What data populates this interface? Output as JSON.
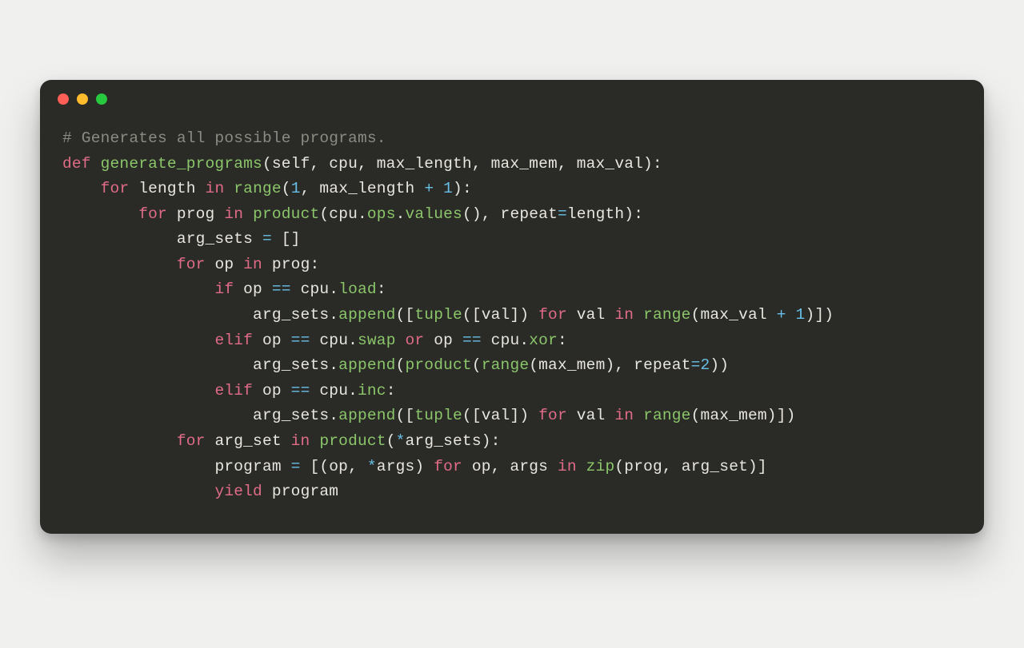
{
  "colors": {
    "window_bg": "#2a2a26",
    "page_bg": "#f0f0ef",
    "traffic_red": "#ff5f56",
    "traffic_yellow": "#ffbd2e",
    "traffic_green": "#27c93f",
    "comment": "#8b8b84",
    "keyword": "#e06c87",
    "function": "#8bc66a",
    "default": "#e8e6df",
    "number": "#68c0e8"
  },
  "code": {
    "lines": [
      {
        "indent": 0,
        "tokens": [
          {
            "t": "# Generates all possible programs.",
            "c": "c-comment"
          }
        ]
      },
      {
        "indent": 0,
        "tokens": [
          {
            "t": "def ",
            "c": "c-kw"
          },
          {
            "t": "generate_programs",
            "c": "c-fn"
          },
          {
            "t": "(",
            "c": "c-id"
          },
          {
            "t": "self",
            "c": "c-self"
          },
          {
            "t": ", cpu, max_length, max_mem, max_val):",
            "c": "c-id"
          }
        ]
      },
      {
        "indent": 1,
        "tokens": [
          {
            "t": "for ",
            "c": "c-kw"
          },
          {
            "t": "length ",
            "c": "c-id"
          },
          {
            "t": "in ",
            "c": "c-kw"
          },
          {
            "t": "range",
            "c": "c-fn"
          },
          {
            "t": "(",
            "c": "c-id"
          },
          {
            "t": "1",
            "c": "c-num"
          },
          {
            "t": ", max_length ",
            "c": "c-id"
          },
          {
            "t": "+ ",
            "c": "c-op"
          },
          {
            "t": "1",
            "c": "c-num"
          },
          {
            "t": "):",
            "c": "c-id"
          }
        ]
      },
      {
        "indent": 2,
        "tokens": [
          {
            "t": "for ",
            "c": "c-kw"
          },
          {
            "t": "prog ",
            "c": "c-id"
          },
          {
            "t": "in ",
            "c": "c-kw"
          },
          {
            "t": "product",
            "c": "c-fn"
          },
          {
            "t": "(cpu.",
            "c": "c-id"
          },
          {
            "t": "ops",
            "c": "c-fn"
          },
          {
            "t": ".",
            "c": "c-id"
          },
          {
            "t": "values",
            "c": "c-fn"
          },
          {
            "t": "(), repeat",
            "c": "c-id"
          },
          {
            "t": "=",
            "c": "c-op"
          },
          {
            "t": "length):",
            "c": "c-id"
          }
        ]
      },
      {
        "indent": 3,
        "tokens": [
          {
            "t": "arg_sets ",
            "c": "c-id"
          },
          {
            "t": "= ",
            "c": "c-op"
          },
          {
            "t": "[]",
            "c": "c-id"
          }
        ]
      },
      {
        "indent": 3,
        "tokens": [
          {
            "t": "for ",
            "c": "c-kw"
          },
          {
            "t": "op ",
            "c": "c-id"
          },
          {
            "t": "in ",
            "c": "c-kw"
          },
          {
            "t": "prog:",
            "c": "c-id"
          }
        ]
      },
      {
        "indent": 4,
        "tokens": [
          {
            "t": "if ",
            "c": "c-kw"
          },
          {
            "t": "op ",
            "c": "c-id"
          },
          {
            "t": "== ",
            "c": "c-op"
          },
          {
            "t": "cpu.",
            "c": "c-id"
          },
          {
            "t": "load",
            "c": "c-fn"
          },
          {
            "t": ":",
            "c": "c-id"
          }
        ]
      },
      {
        "indent": 5,
        "tokens": [
          {
            "t": "arg_sets.",
            "c": "c-id"
          },
          {
            "t": "append",
            "c": "c-fn"
          },
          {
            "t": "([",
            "c": "c-id"
          },
          {
            "t": "tuple",
            "c": "c-fn"
          },
          {
            "t": "([val]) ",
            "c": "c-id"
          },
          {
            "t": "for ",
            "c": "c-kw"
          },
          {
            "t": "val ",
            "c": "c-id"
          },
          {
            "t": "in ",
            "c": "c-kw"
          },
          {
            "t": "range",
            "c": "c-fn"
          },
          {
            "t": "(max_val ",
            "c": "c-id"
          },
          {
            "t": "+ ",
            "c": "c-op"
          },
          {
            "t": "1",
            "c": "c-num"
          },
          {
            "t": ")])",
            "c": "c-id"
          }
        ]
      },
      {
        "indent": 4,
        "tokens": [
          {
            "t": "elif ",
            "c": "c-kw"
          },
          {
            "t": "op ",
            "c": "c-id"
          },
          {
            "t": "== ",
            "c": "c-op"
          },
          {
            "t": "cpu.",
            "c": "c-id"
          },
          {
            "t": "swap",
            "c": "c-fn"
          },
          {
            "t": " ",
            "c": "c-id"
          },
          {
            "t": "or ",
            "c": "c-kw"
          },
          {
            "t": "op ",
            "c": "c-id"
          },
          {
            "t": "== ",
            "c": "c-op"
          },
          {
            "t": "cpu.",
            "c": "c-id"
          },
          {
            "t": "xor",
            "c": "c-fn"
          },
          {
            "t": ":",
            "c": "c-id"
          }
        ]
      },
      {
        "indent": 5,
        "tokens": [
          {
            "t": "arg_sets.",
            "c": "c-id"
          },
          {
            "t": "append",
            "c": "c-fn"
          },
          {
            "t": "(",
            "c": "c-id"
          },
          {
            "t": "product",
            "c": "c-fn"
          },
          {
            "t": "(",
            "c": "c-id"
          },
          {
            "t": "range",
            "c": "c-fn"
          },
          {
            "t": "(max_mem), repeat",
            "c": "c-id"
          },
          {
            "t": "=",
            "c": "c-op"
          },
          {
            "t": "2",
            "c": "c-num"
          },
          {
            "t": "))",
            "c": "c-id"
          }
        ]
      },
      {
        "indent": 4,
        "tokens": [
          {
            "t": "elif ",
            "c": "c-kw"
          },
          {
            "t": "op ",
            "c": "c-id"
          },
          {
            "t": "== ",
            "c": "c-op"
          },
          {
            "t": "cpu.",
            "c": "c-id"
          },
          {
            "t": "inc",
            "c": "c-fn"
          },
          {
            "t": ":",
            "c": "c-id"
          }
        ]
      },
      {
        "indent": 5,
        "tokens": [
          {
            "t": "arg_sets.",
            "c": "c-id"
          },
          {
            "t": "append",
            "c": "c-fn"
          },
          {
            "t": "([",
            "c": "c-id"
          },
          {
            "t": "tuple",
            "c": "c-fn"
          },
          {
            "t": "([val]) ",
            "c": "c-id"
          },
          {
            "t": "for ",
            "c": "c-kw"
          },
          {
            "t": "val ",
            "c": "c-id"
          },
          {
            "t": "in ",
            "c": "c-kw"
          },
          {
            "t": "range",
            "c": "c-fn"
          },
          {
            "t": "(max_mem)])",
            "c": "c-id"
          }
        ]
      },
      {
        "indent": 3,
        "tokens": [
          {
            "t": "for ",
            "c": "c-kw"
          },
          {
            "t": "arg_set ",
            "c": "c-id"
          },
          {
            "t": "in ",
            "c": "c-kw"
          },
          {
            "t": "product",
            "c": "c-fn"
          },
          {
            "t": "(",
            "c": "c-id"
          },
          {
            "t": "*",
            "c": "c-op"
          },
          {
            "t": "arg_sets):",
            "c": "c-id"
          }
        ]
      },
      {
        "indent": 4,
        "tokens": [
          {
            "t": "program ",
            "c": "c-id"
          },
          {
            "t": "= ",
            "c": "c-op"
          },
          {
            "t": "[(op, ",
            "c": "c-id"
          },
          {
            "t": "*",
            "c": "c-op"
          },
          {
            "t": "args) ",
            "c": "c-id"
          },
          {
            "t": "for ",
            "c": "c-kw"
          },
          {
            "t": "op, args ",
            "c": "c-id"
          },
          {
            "t": "in ",
            "c": "c-kw"
          },
          {
            "t": "zip",
            "c": "c-fn"
          },
          {
            "t": "(prog, arg_set)]",
            "c": "c-id"
          }
        ]
      },
      {
        "indent": 4,
        "tokens": [
          {
            "t": "yield ",
            "c": "c-kw"
          },
          {
            "t": "program",
            "c": "c-id"
          }
        ]
      }
    ],
    "indent_unit": "    "
  }
}
